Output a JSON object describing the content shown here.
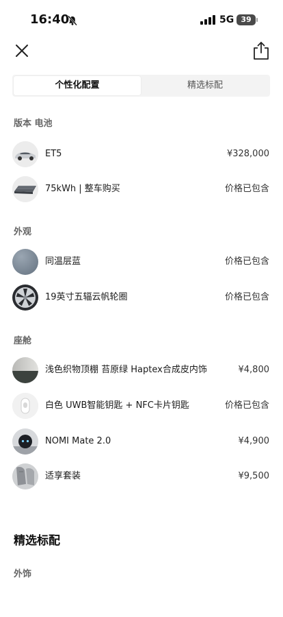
{
  "status_bar": {
    "time": "16:40",
    "network": "5G",
    "battery": "39"
  },
  "tabs": {
    "custom": "个性化配置",
    "standard": "精选标配"
  },
  "sections": {
    "version": "版本 电池",
    "exterior": "外观",
    "cabin": "座舱"
  },
  "items": [
    {
      "label": "ET5",
      "price": "¥328,000",
      "icon": "car-thumbnail"
    },
    {
      "label": "75kWh | 整车购买",
      "price": "价格已包含",
      "icon": "battery-pack-thumbnail"
    },
    {
      "label": "同温层蓝",
      "price": "价格已包含",
      "icon": "paint-swatch-thumbnail"
    },
    {
      "label": "19英寸五辐云帆轮圈",
      "price": "价格已包含",
      "icon": "wheel-rim-thumbnail"
    },
    {
      "label": "浅色织物顶棚 苔原绿 Haptex合成皮内饰",
      "price": "¥4,800",
      "icon": "interior-swatch-thumbnail"
    },
    {
      "label": "白色 UWB智能钥匙 + NFC卡片钥匙",
      "price": "价格已包含",
      "icon": "key-fob-thumbnail"
    },
    {
      "label": "NOMI Mate 2.0",
      "price": "¥4,900",
      "icon": "nomi-robot-thumbnail"
    },
    {
      "label": "适享套装",
      "price": "¥9,500",
      "icon": "seat-package-thumbnail"
    }
  ],
  "standard": {
    "title": "精选标配",
    "subtitle": "外饰"
  },
  "colors": {
    "stratosphere_blue": "#7d8a98",
    "segment_bg": "#f3f3f3"
  }
}
